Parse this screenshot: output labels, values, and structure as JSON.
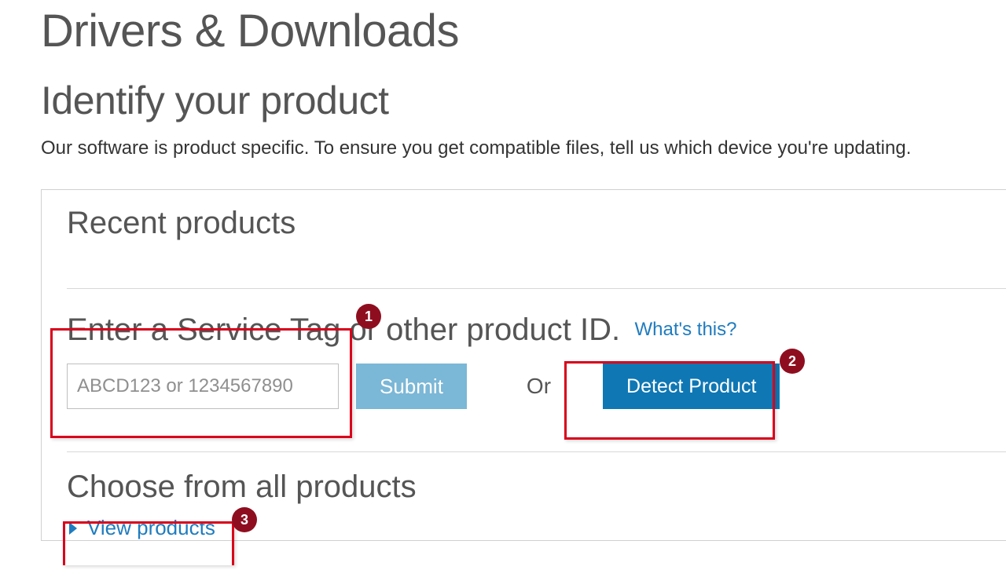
{
  "page": {
    "title": "Drivers & Downloads",
    "subtitle": "Identify your product",
    "description": "Our software is product specific. To ensure you get compatible files, tell us which device you're updating."
  },
  "panel": {
    "recent_title": "Recent products",
    "enter_heading": "Enter a Service Tag or other product ID.",
    "whats_this": "What's this?",
    "input_placeholder": "ABCD123 or 1234567890",
    "submit_label": "Submit",
    "or_label": "Or",
    "detect_label": "Detect Product",
    "choose_title": "Choose from all products",
    "view_products": "View products"
  },
  "annotations": {
    "badge1": "1",
    "badge2": "2",
    "badge3": "3"
  }
}
